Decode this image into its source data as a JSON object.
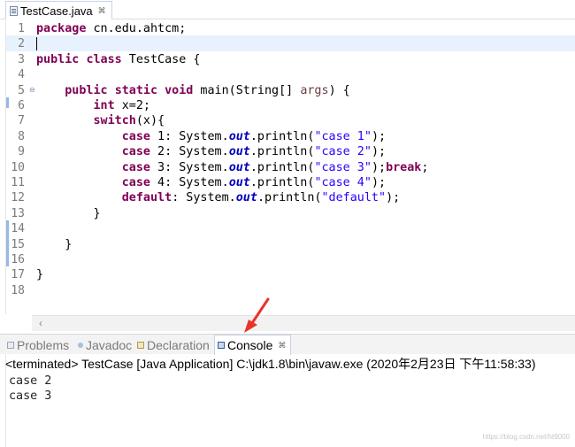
{
  "editor_tab": {
    "title": "TestCase.java",
    "close_glyph": "⌘"
  },
  "code_lines": [
    {
      "num": "1"
    },
    {
      "num": "2"
    },
    {
      "num": "3"
    },
    {
      "num": "4"
    },
    {
      "num": "5"
    },
    {
      "num": "6"
    },
    {
      "num": "7"
    },
    {
      "num": "8"
    },
    {
      "num": "9"
    },
    {
      "num": "10"
    },
    {
      "num": "11"
    },
    {
      "num": "12"
    },
    {
      "num": "13"
    },
    {
      "num": "14"
    },
    {
      "num": "15"
    },
    {
      "num": "16"
    },
    {
      "num": "17"
    },
    {
      "num": "18"
    }
  ],
  "code": {
    "l1_kw": "package",
    "l1_rest": " cn.edu.ahtcm;",
    "l3_kw1": "public",
    "l3_kw2": "class",
    "l3_rest": " TestCase {",
    "l5_kw1": "public",
    "l5_kw2": "static",
    "l5_kw3": "void",
    "l5_mid": " main(String[] ",
    "l5_param": "args",
    "l5_end": ") {",
    "l6_kw": "int",
    "l6_rest": " x=2;",
    "l7_kw": "switch",
    "l7_rest": "(x){",
    "c1_kw": "case",
    "c1_pre": " 1: System.",
    "c1_fld": "out",
    "c1_mid": ".println(",
    "c1_str": "\"case 1\"",
    "c1_end": ");",
    "c2_kw": "case",
    "c2_pre": " 2: System.",
    "c2_fld": "out",
    "c2_mid": ".println(",
    "c2_str": "\"case 2\"",
    "c2_end": ");",
    "c3_kw": "case",
    "c3_pre": " 3: System.",
    "c3_fld": "out",
    "c3_mid": ".println(",
    "c3_str": "\"case 3\"",
    "c3_end": ");",
    "c3_break": "break",
    "c3_semi": ";",
    "c4_kw": "case",
    "c4_pre": " 4: System.",
    "c4_fld": "out",
    "c4_mid": ".println(",
    "c4_str": "\"case 4\"",
    "c4_end": ");",
    "d_kw": "default",
    "d_pre": ": System.",
    "d_fld": "out",
    "d_mid": ".println(",
    "d_str": "\"default\"",
    "d_end": ");",
    "l13": "}",
    "l15": "}",
    "l17": "}"
  },
  "view_tabs": {
    "problems": "Problems",
    "javadoc": "Javadoc",
    "declaration": "Declaration",
    "console": "Console",
    "console_close": "⌘"
  },
  "console": {
    "header": "<terminated> TestCase [Java Application] C:\\jdk1.8\\bin\\javaw.exe (2020年2月23日 下午11:58:33)",
    "output": [
      "case 2",
      "case 3"
    ]
  },
  "watermark": "https://blog.csdn.net/ht9000",
  "colors": {
    "keyword": "#7f0055",
    "string": "#2a00ff",
    "field": "#0000c0",
    "annotation_arrow": "#e8352b"
  }
}
